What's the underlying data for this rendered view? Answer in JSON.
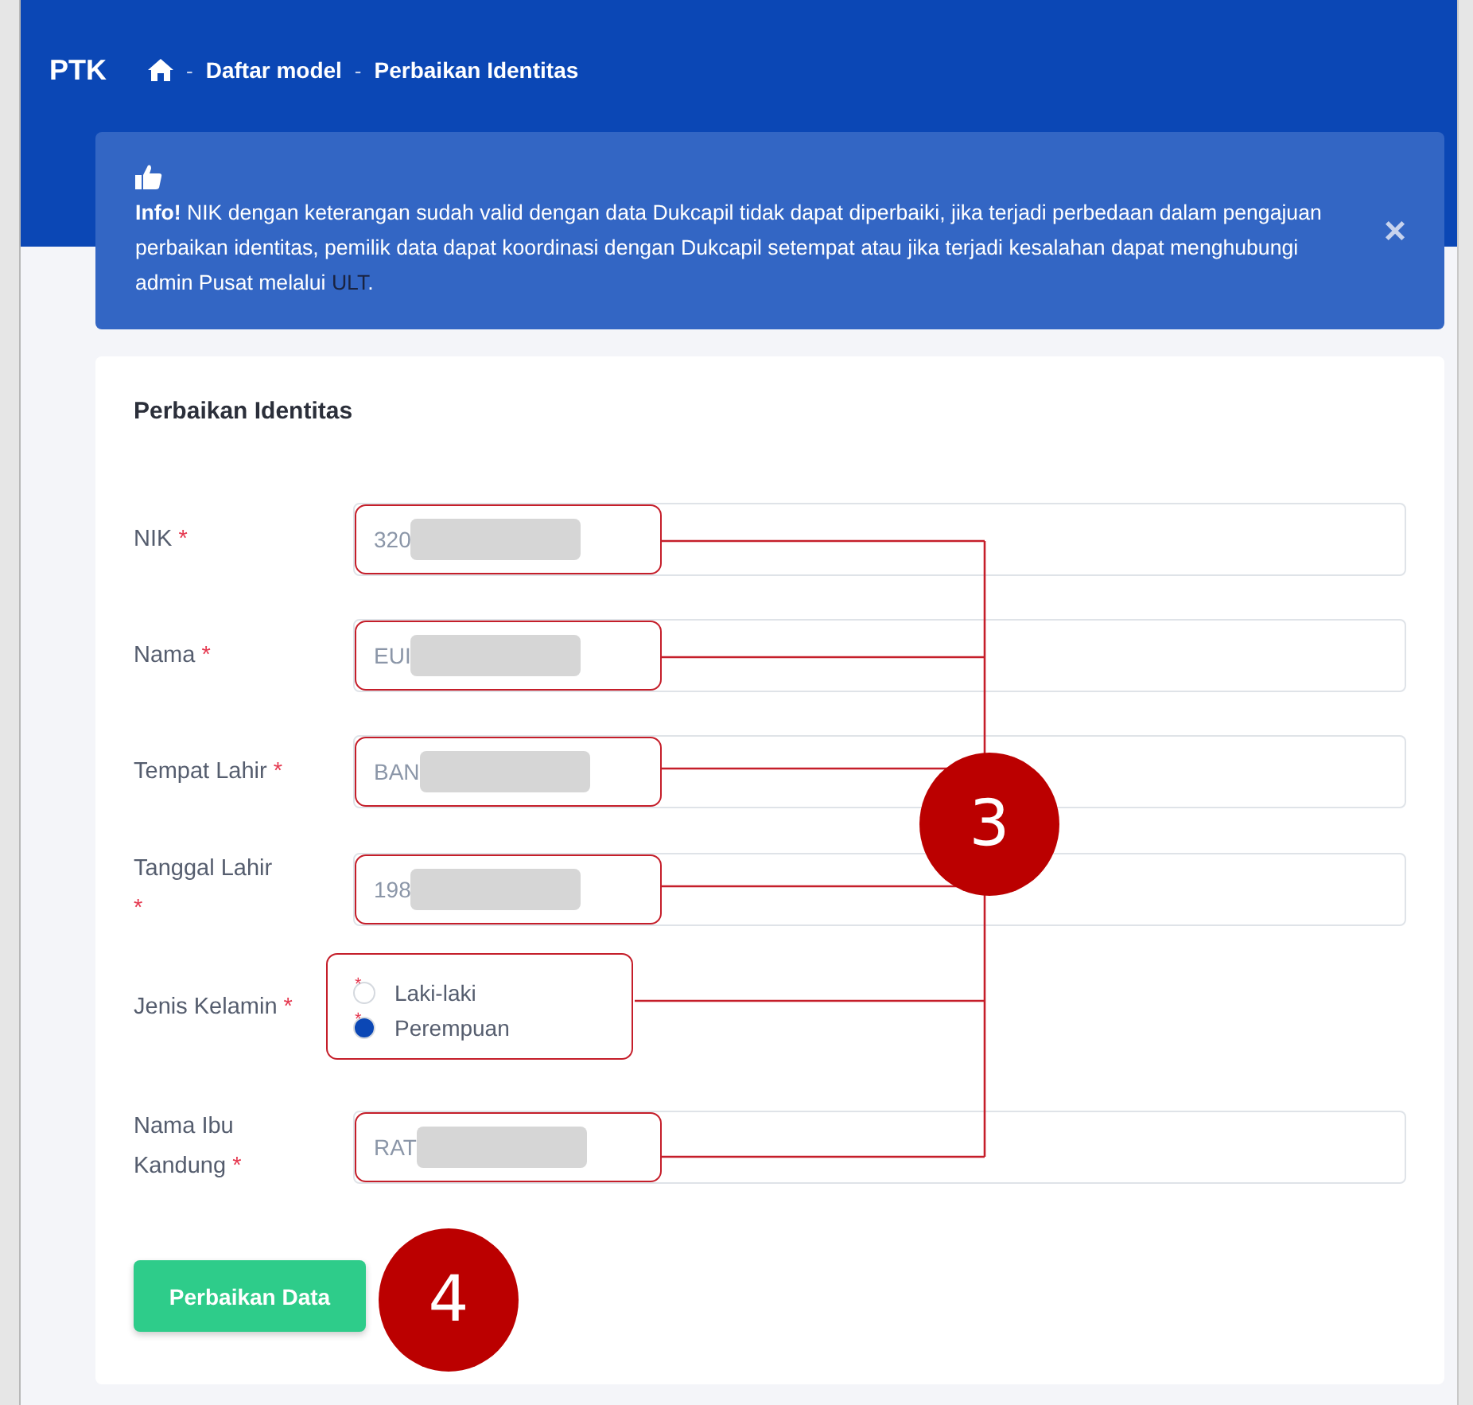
{
  "header": {
    "title": "PTK",
    "breadcrumb": [
      "Daftar model",
      "Perbaikan Identitas"
    ],
    "separator": "-"
  },
  "alert": {
    "text": "**Info!** NIK dengan keterangan sudah valid dengan data Dukcapil tidak dapat diperbaiki, jika terjadi perbedaan dalam pengajuan perbaikan identitas, pemilik data dapat koordinasi dengan Dukcapil setempat atau jika terjadi kesalahan dapat menghubungi admin Pusat melalui ",
    "link": "ULT",
    "end": ".",
    "close": "×"
  },
  "form": {
    "title": "Perbaikan Identitas",
    "required_mark": "*",
    "fields": [
      {
        "kind": "text",
        "label": "NIK",
        "value": "320",
        "redacted": true,
        "highlighted": true
      },
      {
        "kind": "text",
        "label": "Nama",
        "value": "EUI",
        "redacted": true,
        "highlighted": true
      },
      {
        "kind": "text",
        "label": "Tempat Lahir",
        "value": "BAN",
        "redacted": true,
        "highlighted": true
      },
      {
        "kind": "text",
        "label": "Tanggal Lahir",
        "value": "198",
        "redacted": true,
        "highlighted": true
      },
      {
        "kind": "radio",
        "label": "Jenis Kelamin",
        "highlighted": true,
        "options": [
          {
            "label": "Laki-laki",
            "mark": "*",
            "selected": false
          },
          {
            "label": "Perempuan",
            "mark": "*",
            "selected": true
          }
        ]
      },
      {
        "kind": "text",
        "label": "Nama Ibu Kandung",
        "value": "RAT",
        "redacted": true,
        "highlighted": true
      }
    ],
    "submit": "Perbaikan Data"
  },
  "callouts": [
    {
      "label": "3"
    },
    {
      "label": "4"
    }
  ]
}
